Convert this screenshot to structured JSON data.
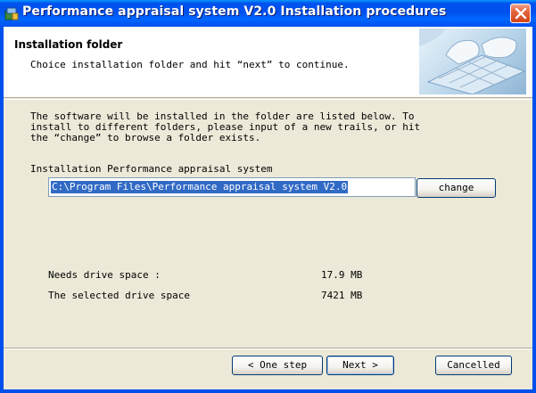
{
  "window": {
    "title": "Performance appraisal system V2.0 Installation procedures",
    "title_bar_color": "#0053EE",
    "close_button_color": "#D2441A"
  },
  "header": {
    "title": "Installation folder",
    "subtitle": "Choice installation folder and hit “next” to continue."
  },
  "main": {
    "description": "The software will be installed in the folder are listed below. To\ninstall to different folders, please input of a new trails, or hit\nthe “change” to browse a folder exists.",
    "folder_label": "Installation Performance appraisal system",
    "folder_path": "C:\\Program Files\\Performance appraisal system V2.0",
    "change_label": "change",
    "needs_label": "Needs drive space :",
    "needs_value": "17.9 MB",
    "selected_label": "The selected drive space",
    "selected_value": "7421 MB"
  },
  "footer": {
    "back_label": "< One step",
    "next_label": "Next >",
    "cancel_label": "Cancelled"
  },
  "icons": [
    "installer-icon",
    "close-icon",
    "keyboard-hands-image"
  ]
}
